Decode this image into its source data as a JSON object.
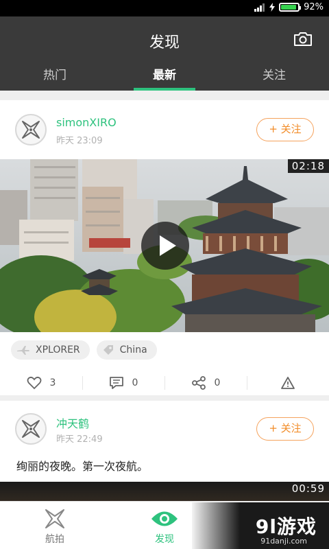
{
  "status": {
    "battery_text": "92%",
    "battery_level": 0.92
  },
  "header": {
    "title": "发现",
    "camera_icon": "camera-icon"
  },
  "tabs": [
    {
      "label": "热门",
      "active": false
    },
    {
      "label": "最新",
      "active": true
    },
    {
      "label": "关注",
      "active": false
    }
  ],
  "posts": [
    {
      "username": "simonXIRO",
      "time": "昨天 23:09",
      "follow_label": "+ 关注",
      "duration": "02:18",
      "tags": [
        {
          "icon": "drone-icon",
          "label": "XPLORER"
        },
        {
          "icon": "location-icon",
          "label": "China"
        }
      ],
      "likes": "3",
      "comments": "0",
      "shares": "0"
    },
    {
      "username": "冲天鹤",
      "time": "昨天 22:49",
      "follow_label": "+ 关注",
      "text": "绚丽的夜晚。第一次夜航。",
      "duration": "00:59"
    }
  ],
  "bottom_nav": [
    {
      "label": "航拍",
      "icon": "drone-icon",
      "active": false
    },
    {
      "label": "发现",
      "icon": "eye-icon",
      "active": true
    },
    {
      "label": "",
      "icon": "profile-icon",
      "active": false
    }
  ],
  "watermark": {
    "main": "9l游戏",
    "sub": "91danji.com"
  },
  "colors": {
    "accent": "#2ec27e",
    "follow": "#f28c28",
    "header_bg": "#3a3a3a"
  }
}
